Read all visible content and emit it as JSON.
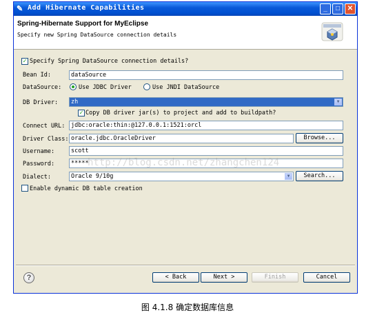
{
  "window": {
    "title": "Add Hibernate Capabilities"
  },
  "header": {
    "title": "Spring-Hibernate Support for MyEclipse",
    "subtitle": "Specify new Spring DataSource connection details"
  },
  "form": {
    "specify_checkbox": {
      "label": "Specify Spring DataSource connection details?",
      "checked": true
    },
    "bean_id": {
      "label": "Bean Id:",
      "value": "dataSource"
    },
    "datasource": {
      "label": "DataSource:",
      "option_jdbc": "Use JDBC Driver",
      "option_jndi": "Use JNDI DataSource",
      "selected": "Use JDBC Driver"
    },
    "db_driver": {
      "label": "DB Driver:",
      "value": "zh"
    },
    "copy_jar": {
      "label": "Copy DB driver jar(s) to project and add to buildpath?",
      "checked": true
    },
    "connect_url": {
      "label": "Connect URL:",
      "value": "jdbc:oracle:thin:@127.0.0.1:1521:orcl"
    },
    "driver_class": {
      "label": "Driver Class:",
      "value": "oracle.jdbc.OracleDriver",
      "browse": "Browse..."
    },
    "username": {
      "label": "Username:",
      "value": "scott"
    },
    "password": {
      "label": "Password:",
      "value": "*****"
    },
    "dialect": {
      "label": "Dialect:",
      "value": "Oracle 9/10g",
      "search": "Search..."
    },
    "dynamic_table": {
      "label": "Enable dynamic DB table creation",
      "checked": false
    }
  },
  "footer": {
    "back": "< Back",
    "next": "Next >",
    "finish": "Finish",
    "cancel": "Cancel"
  },
  "watermark": "http://blog.csdn.net/zhangchen124",
  "caption": "图 4.1.8  确定数据库信息",
  "colors": {
    "titlebar": "#0a5ad9",
    "selection": "#316ac5",
    "check": "#21a121"
  }
}
